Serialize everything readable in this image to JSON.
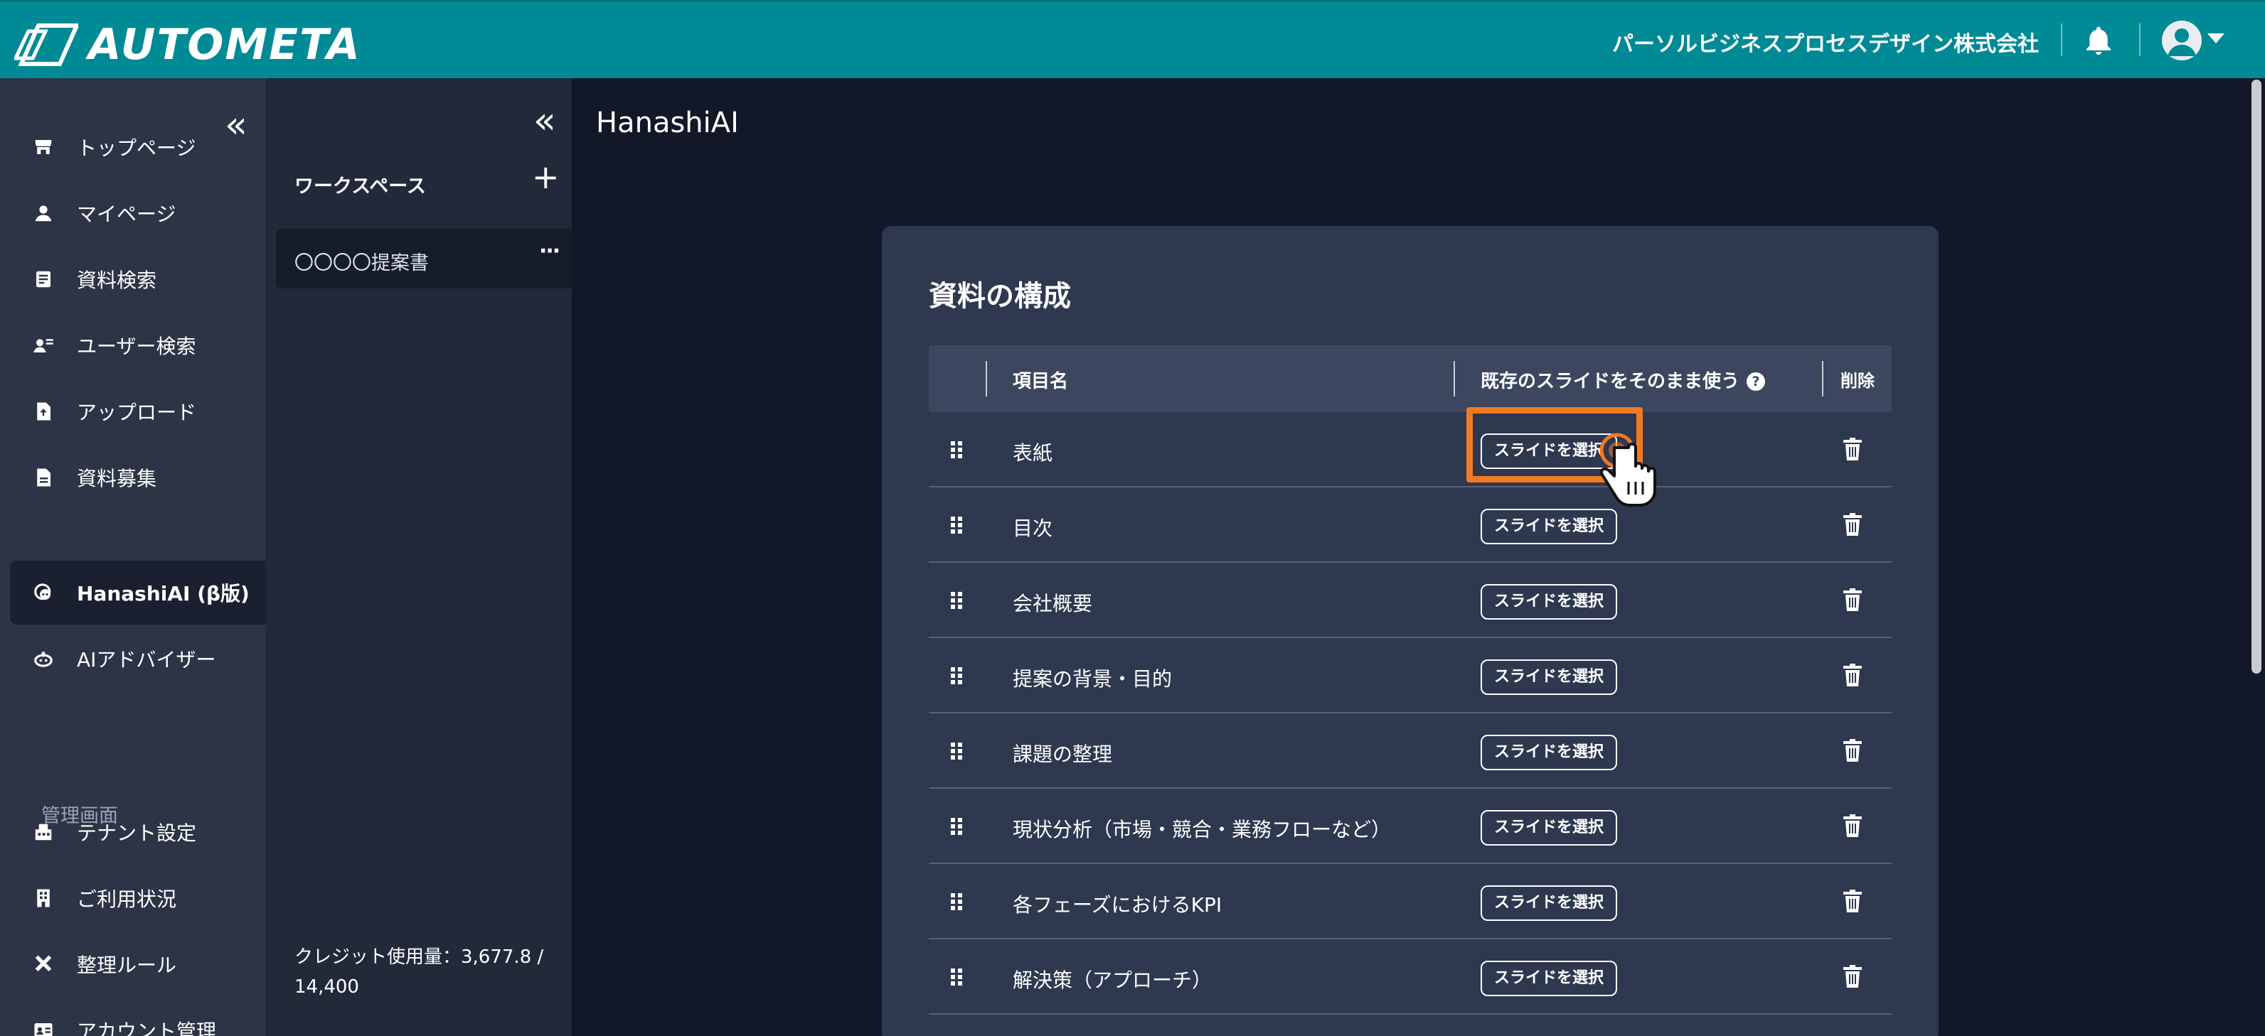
{
  "header": {
    "brand": "AUTOMETA",
    "company": "パーソルビジネスプロセスデザイン株式会社",
    "accent": "#008a96"
  },
  "nav": {
    "collapse_icon": "«",
    "items": [
      {
        "label": "トップページ",
        "icon": "store-icon"
      },
      {
        "label": "マイページ",
        "icon": "person-icon"
      },
      {
        "label": "資料検索",
        "icon": "document-search-icon"
      },
      {
        "label": "ユーザー検索",
        "icon": "user-search-icon"
      },
      {
        "label": "アップロード",
        "icon": "file-upload-icon"
      },
      {
        "label": "資料募集",
        "icon": "file-icon"
      },
      {
        "label": "HanashiAI (β版)",
        "icon": "chat-ai-icon"
      },
      {
        "label": "AIアドバイザー",
        "icon": "robot-icon"
      }
    ],
    "section_label": "管理画面",
    "admin_items": [
      {
        "label": "テナント設定",
        "icon": "tenant-icon"
      },
      {
        "label": "ご利用状況",
        "icon": "building-icon"
      },
      {
        "label": "整理ルール",
        "icon": "tools-icon"
      },
      {
        "label": "アカウント管理",
        "icon": "id-card-icon"
      }
    ]
  },
  "workspace": {
    "collapse_icon": "«",
    "title": "ワークスペース",
    "add_icon": "+",
    "item_label": "〇〇〇〇提案書",
    "item_menu": "···",
    "credit": "クレジット使用量：3,677.8 / 14,400"
  },
  "main": {
    "page_title": "HanashiAI",
    "card_title": "資料の構成",
    "columns": {
      "item_name": "項目名",
      "use_existing": "既存のスライドをそのまま使う",
      "help": "?",
      "delete": "削除"
    },
    "select_button": "スライドを選択",
    "rows": [
      "表紙",
      "目次",
      "会社概要",
      "提案の背景・目的",
      "課題の整理",
      "現状分析（市場・競合・業務フローなど）",
      "各フェーズにおけるKPI",
      "解決策（アプローチ）"
    ]
  },
  "colors": {
    "highlight": "#f07a22",
    "card": "#2e384f",
    "page_bg": "#121827"
  }
}
